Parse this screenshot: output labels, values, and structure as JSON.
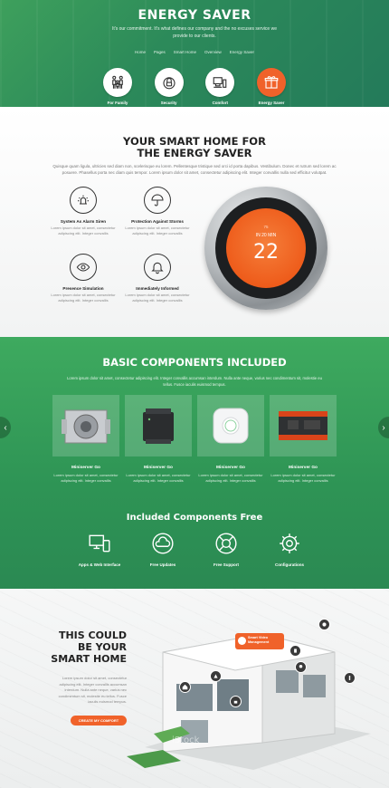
{
  "hero": {
    "title": "ENERGY SAVER",
    "subtitle": "It's our commitment. It's what defines our company and the no excuses service we provide to our clients.",
    "breadcrumb": [
      "Home",
      "Pages",
      "Smart Home",
      "Overview",
      "Energy Saver"
    ],
    "features": [
      {
        "label": "For Family",
        "icon": "family-icon",
        "active": false
      },
      {
        "label": "Security",
        "icon": "lock-icon",
        "active": false
      },
      {
        "label": "Comfort",
        "icon": "comfort-icon",
        "active": false
      },
      {
        "label": "Energy Saver",
        "icon": "box-icon",
        "active": true
      }
    ]
  },
  "smart": {
    "title_line1": "YOUR SMART HOME FOR",
    "title_line2": "THE ENERGY SAVER",
    "description": "Quisque quam ligula, ultricies sed diam non, scelerisque eu lorem. Pellentesque tristique sed orci id porta dapibus. Vestibulum. Donec et rutrum sed lorem ac posuere. Phasellus porta nec diam quis tempor. Lorem ipsum dolor sit amet, consectetur adipiscing elit. Integer convallis nulla sed efficitur volutpat.",
    "features": [
      {
        "title": "System As Alarm Siren",
        "text": "Lorem ipsum dolor sit amet, consectetur adipiscing elit. Integer convallis",
        "icon": "alarm-icon"
      },
      {
        "title": "Protection Against Storms",
        "text": "Lorem ipsum dolor sit amet, consectetur adipiscing elit. Integer convallis",
        "icon": "umbrella-icon"
      },
      {
        "title": "Presence Simulation",
        "text": "Lorem ipsum dolor sit amet, consectetur adipiscing elit. Integer convallis",
        "icon": "eye-icon"
      },
      {
        "title": "Immediately Informed",
        "text": "Lorem ipsum dolor sit amet, consectetur adipiscing elit. Integer convallis",
        "icon": "bell-icon"
      }
    ],
    "thermostat": {
      "top_label": "75",
      "mode": "IN 20 MIN",
      "temperature": "22"
    }
  },
  "components": {
    "title": "BASIC COMPONENTS INCLUDED",
    "description": "Lorem ipsum dolor sit amet, consectetur adipiscing elit. Integer convallis accumsan interdum. Nulla ante neque, varius nec condimentum sit, molestie eu tellus. Fusce iaculis euismod tempus.",
    "cards": [
      {
        "title": "Miniserver Go",
        "text": "Lorem ipsum dolor sit amet, consectetur adipiscing elit. Integer convallis"
      },
      {
        "title": "Miniserver Go",
        "text": "Lorem ipsum dolor sit amet, consectetur adipiscing elit. Integer convallis"
      },
      {
        "title": "Miniserver Go",
        "text": "Lorem ipsum dolor sit amet, consectetur adipiscing elit. Integer convallis"
      },
      {
        "title": "Miniserver Go",
        "text": "Lorem ipsum dolor sit amet, consectetur adipiscing elit. Integer convallis"
      }
    ],
    "prev_arrow": "‹",
    "next_arrow": "›"
  },
  "free": {
    "title": "Included Components Free",
    "items": [
      {
        "label": "Apps & Web Interface",
        "icon": "devices-icon"
      },
      {
        "label": "Free Updates",
        "icon": "cloud-update-icon"
      },
      {
        "label": "Free Support",
        "icon": "lifebuoy-icon"
      },
      {
        "label": "Configurations",
        "icon": "gear-icon"
      }
    ]
  },
  "house": {
    "title_line1": "THIS COULD",
    "title_line2": "BE YOUR",
    "title_line3": "SMART HOME",
    "text": "Lorem ipsum dolor sit amet, consectetur adipiscing elit. Integer convallis accumsan interdum. Nulla ante neque, varius nec condimentum sit, molestie eu tellus. Fusce iaculis euismod tempus.",
    "cta": "CREATE MY COMFORT",
    "tag_line1": "Smart Video",
    "tag_line2": "Management",
    "watermark": "iStock"
  },
  "colors": {
    "accent": "#f0622a",
    "green": "#2e9455",
    "dark": "#222222"
  }
}
